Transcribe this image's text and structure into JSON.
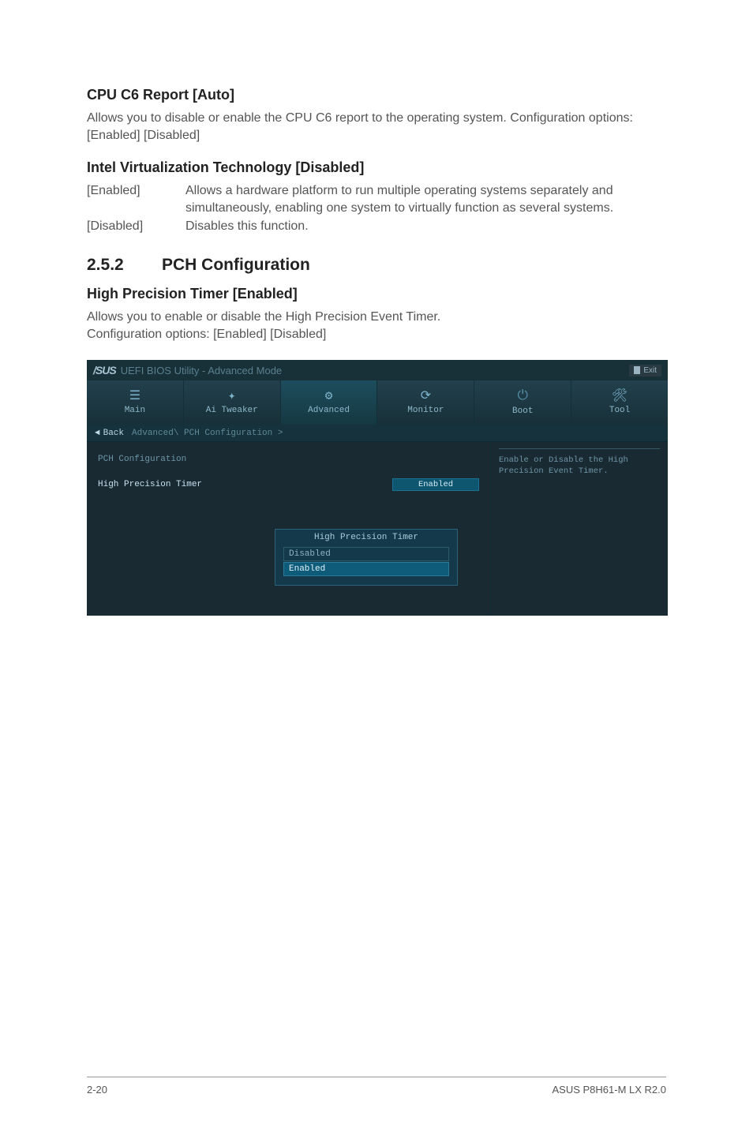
{
  "sections": {
    "cpu_c6": {
      "heading": "CPU C6 Report [Auto]",
      "body": "Allows you to disable or enable the CPU C6 report to the operating system. Configuration options: [Enabled] [Disabled]"
    },
    "intel_vt": {
      "heading": "Intel Virtualization Technology [Disabled]",
      "rows": [
        {
          "term": "[Enabled]",
          "desc": "Allows a hardware platform to run multiple operating systems separately and simultaneously, enabling one system to virtually function as several systems."
        },
        {
          "term": "[Disabled]",
          "desc": "Disables this function."
        }
      ]
    },
    "pch": {
      "number": "2.5.2",
      "title": "PCH Configuration",
      "sub_heading": "High Precision Timer [Enabled]",
      "body_line1": "Allows you to enable or disable the High Precision Event Timer.",
      "body_line2": "Configuration options: [Enabled] [Disabled]"
    }
  },
  "bios": {
    "logo": "/SUS",
    "title": "UEFI BIOS Utility - Advanced Mode",
    "exit_label": "Exit",
    "tabs": [
      {
        "icon": "☰",
        "label": "Main"
      },
      {
        "icon": "✦",
        "label": "Ai Tweaker"
      },
      {
        "icon": "⚙",
        "label": "Advanced",
        "active": true
      },
      {
        "icon": "⟳",
        "label": "Monitor"
      },
      {
        "icon": "⏻",
        "label": "Boot"
      },
      {
        "icon": "🛠",
        "label": "Tool"
      }
    ],
    "back_label": "Back",
    "breadcrumb": "Advanced\\ PCH Configuration >",
    "panel_title": "PCH Configuration",
    "setting_name": "High Precision Timer",
    "setting_value": "Enabled",
    "help_text": "Enable or Disable the High Precision Event Timer.",
    "popup": {
      "title": "High Precision Timer",
      "options": [
        "Disabled",
        "Enabled"
      ],
      "selected": "Enabled"
    }
  },
  "footer": {
    "left": "2-20",
    "right": "ASUS P8H61-M LX R2.0"
  }
}
